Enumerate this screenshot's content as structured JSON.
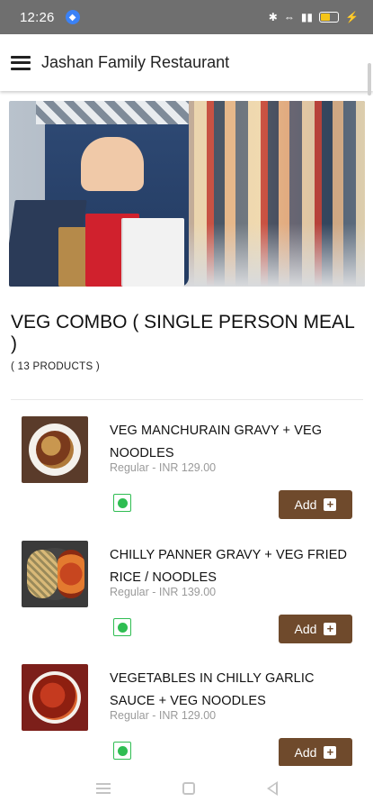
{
  "status_bar": {
    "time": "12:26",
    "charge_symbol": "⚡"
  },
  "app_bar": {
    "title": "Jashan Family Restaurant"
  },
  "category": {
    "title": "VEG COMBO ( SINGLE PERSON MEAL )",
    "count": "( 13 PRODUCTS )"
  },
  "products": [
    {
      "name": "VEG MANCHURAIN GRAVY + VEG NOODLES",
      "price": "Regular - INR 129.00",
      "add_label": "Add"
    },
    {
      "name": "CHILLY PANNER GRAVY + VEG FRIED RICE / NOODLES",
      "price": "Regular - INR 139.00",
      "add_label": "Add"
    },
    {
      "name": "VEGETABLES IN CHILLY GARLIC SAUCE + VEG NOODLES",
      "price": "Regular - INR 129.00",
      "add_label": "Add"
    }
  ],
  "colors": {
    "accent": "#6f4a2c",
    "veg": "#2fbd52"
  }
}
